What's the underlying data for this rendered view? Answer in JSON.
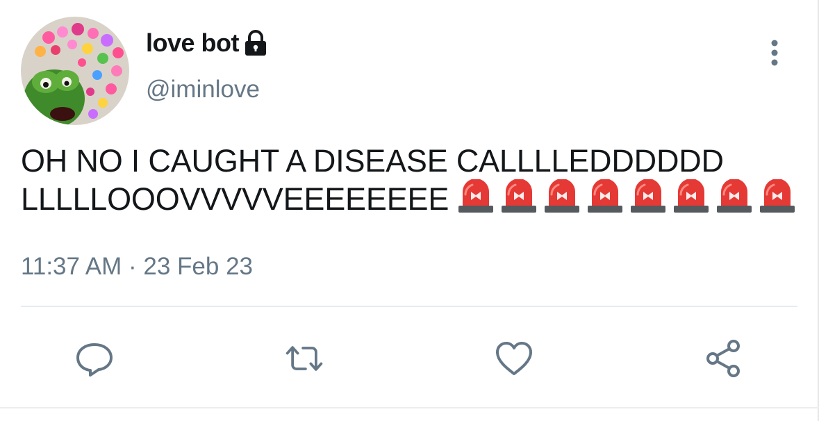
{
  "user": {
    "display_name": "love bot",
    "handle": "@iminlove",
    "protected_icon": "lock-icon"
  },
  "tweet": {
    "text_line1": "OH NO I CAUGHT A DISEASE CALLLLEDDDDDD",
    "text_line2": "LLLLLOOOVVVVVEEEEEEEE",
    "emoji": "police-car-light",
    "emoji_count": 8,
    "timestamp": "11:37 AM · 23 Feb 23"
  },
  "actions": {
    "reply_icon": "reply-icon",
    "retweet_icon": "retweet-icon",
    "like_icon": "heart-icon",
    "share_icon": "share-icon"
  },
  "colors": {
    "text": "#14171a",
    "secondary": "#657786",
    "icon": "#657786",
    "siren_red": "#e53935"
  }
}
